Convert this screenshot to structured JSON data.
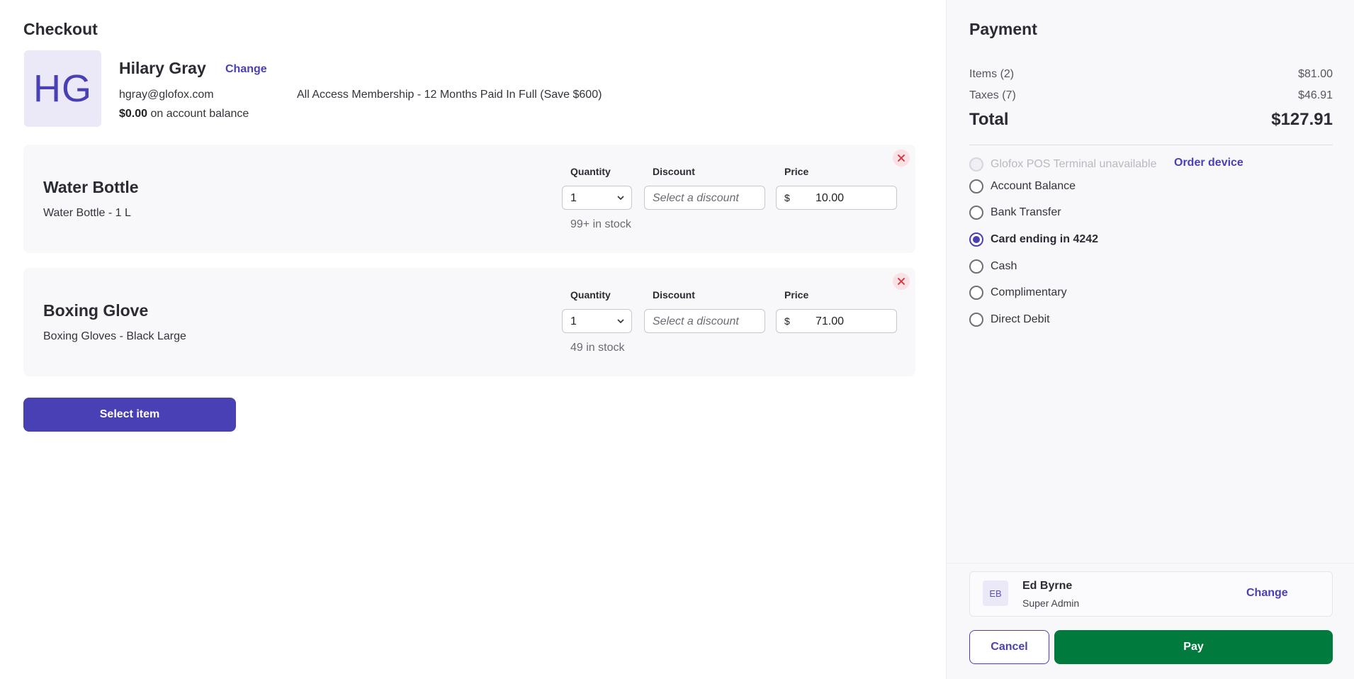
{
  "checkout": {
    "title": "Checkout",
    "client": {
      "initials": "HG",
      "name": "Hilary Gray",
      "change_label": "Change",
      "email": "hgray@glofox.com",
      "balance_amount": "$0.00",
      "balance_suffix": " on account balance",
      "membership": "All Access Membership - 12 Months Paid In Full (Save $600)"
    },
    "column_labels": {
      "quantity": "Quantity",
      "discount": "Discount",
      "price": "Price"
    },
    "items": [
      {
        "name": "Water Bottle",
        "variant": "Water Bottle - 1 L",
        "quantity": "1",
        "discount_placeholder": "Select a discount",
        "currency": "$",
        "price": "10.00",
        "stock": "99+ in stock"
      },
      {
        "name": "Boxing Glove",
        "variant": "Boxing Gloves - Black Large",
        "quantity": "1",
        "discount_placeholder": "Select a discount",
        "currency": "$",
        "price": "71.00",
        "stock": "49 in stock"
      }
    ],
    "select_item_label": "Select item"
  },
  "payment": {
    "title": "Payment",
    "items_label": "Items (2)",
    "items_value": "$81.00",
    "taxes_label": "Taxes (7)",
    "taxes_value": "$46.91",
    "total_label": "Total",
    "total_value": "$127.91",
    "methods": [
      {
        "label": "Glofox POS Terminal unavailable",
        "state": "disabled"
      },
      {
        "label": "Account Balance",
        "state": "unchecked"
      },
      {
        "label": "Bank Transfer",
        "state": "unchecked"
      },
      {
        "label": "Card ending in 4242",
        "state": "checked"
      },
      {
        "label": "Cash",
        "state": "unchecked"
      },
      {
        "label": "Complimentary",
        "state": "unchecked"
      },
      {
        "label": "Direct Debit",
        "state": "unchecked"
      }
    ],
    "order_device_label": "Order device",
    "staff": {
      "initials": "EB",
      "name": "Ed Byrne",
      "role": "Super Admin",
      "change_label": "Change"
    },
    "cancel_label": "Cancel",
    "pay_label": "Pay"
  },
  "colors": {
    "brand": "#4a40b6",
    "pay_button": "#017a3e",
    "remove_bg": "#f9e1e4",
    "remove_icon": "#d92d3a"
  }
}
